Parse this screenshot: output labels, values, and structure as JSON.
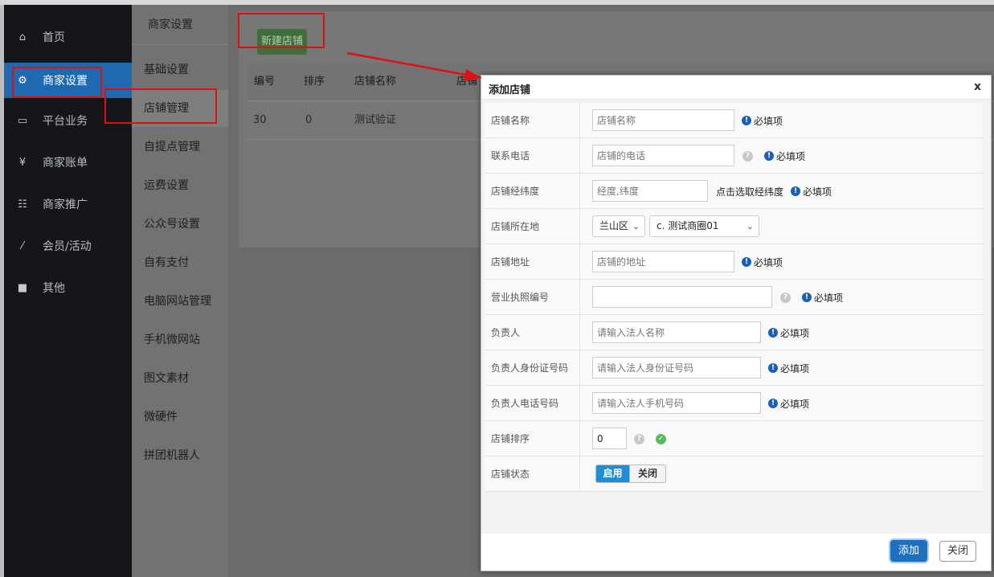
{
  "sidebar": {
    "items": [
      {
        "icon": "home-icon",
        "glyph": "⌂",
        "label": "首页"
      },
      {
        "icon": "gear-icon",
        "glyph": "⚙",
        "label": "商家设置"
      },
      {
        "icon": "monitor-icon",
        "glyph": "▭",
        "label": "平台业务"
      },
      {
        "icon": "yen-icon",
        "glyph": "¥",
        "label": "商家账单"
      },
      {
        "icon": "qrcode-icon",
        "glyph": "☷",
        "label": "商家推广"
      },
      {
        "icon": "magic-wand-icon",
        "glyph": "⁄",
        "label": "会员/活动"
      },
      {
        "icon": "briefcase-icon",
        "glyph": "■",
        "label": "其他"
      }
    ]
  },
  "submenu": {
    "title": "商家设置",
    "items": [
      "基础设置",
      "店铺管理",
      "自提点管理",
      "运费设置",
      "公众号设置",
      "自有支付",
      "电脑网站管理",
      "手机微网站",
      "图文素材",
      "微硬件",
      "拼团机器人"
    ]
  },
  "main": {
    "new_store_button": "新建店铺",
    "table": {
      "headers": [
        "编号",
        "排序",
        "店铺名称",
        "店铺"
      ],
      "rows": [
        [
          "30",
          "0",
          "测试验证"
        ]
      ]
    }
  },
  "modal": {
    "title": "添加店铺",
    "close": "x",
    "required": "必填项",
    "fields": {
      "name": {
        "label": "店铺名称",
        "placeholder": "店铺名称"
      },
      "phone": {
        "label": "联系电话",
        "placeholder": "店铺的电话"
      },
      "coords": {
        "label": "店铺经纬度",
        "placeholder": "经度,纬度",
        "pick_hint": "点击选取经纬度"
      },
      "location": {
        "label": "店铺所在地",
        "district": "兰山区",
        "mall": "c. 测试商圈01"
      },
      "address": {
        "label": "店铺地址",
        "placeholder": "店铺的地址"
      },
      "license": {
        "label": "营业执照编号",
        "placeholder": ""
      },
      "owner": {
        "label": "负责人",
        "placeholder": "请输入法人名称"
      },
      "owner_id": {
        "label": "负责人身份证号码",
        "placeholder": "请输入法人身份证号码"
      },
      "owner_phone": {
        "label": "负责人电话号码",
        "placeholder": "请输入法人手机号码"
      },
      "sort": {
        "label": "店铺排序",
        "value": "0"
      },
      "status": {
        "label": "店铺状态",
        "on": "启用",
        "off": "关闭"
      }
    },
    "add_button": "添加",
    "close_button": "关闭"
  },
  "colors": {
    "sidebar_bg": "#15161a",
    "active_blue": "#1f69b0",
    "highlight_red": "#e01010",
    "info_blue": "#1b5fb6",
    "ok_green": "#5cb85c"
  }
}
